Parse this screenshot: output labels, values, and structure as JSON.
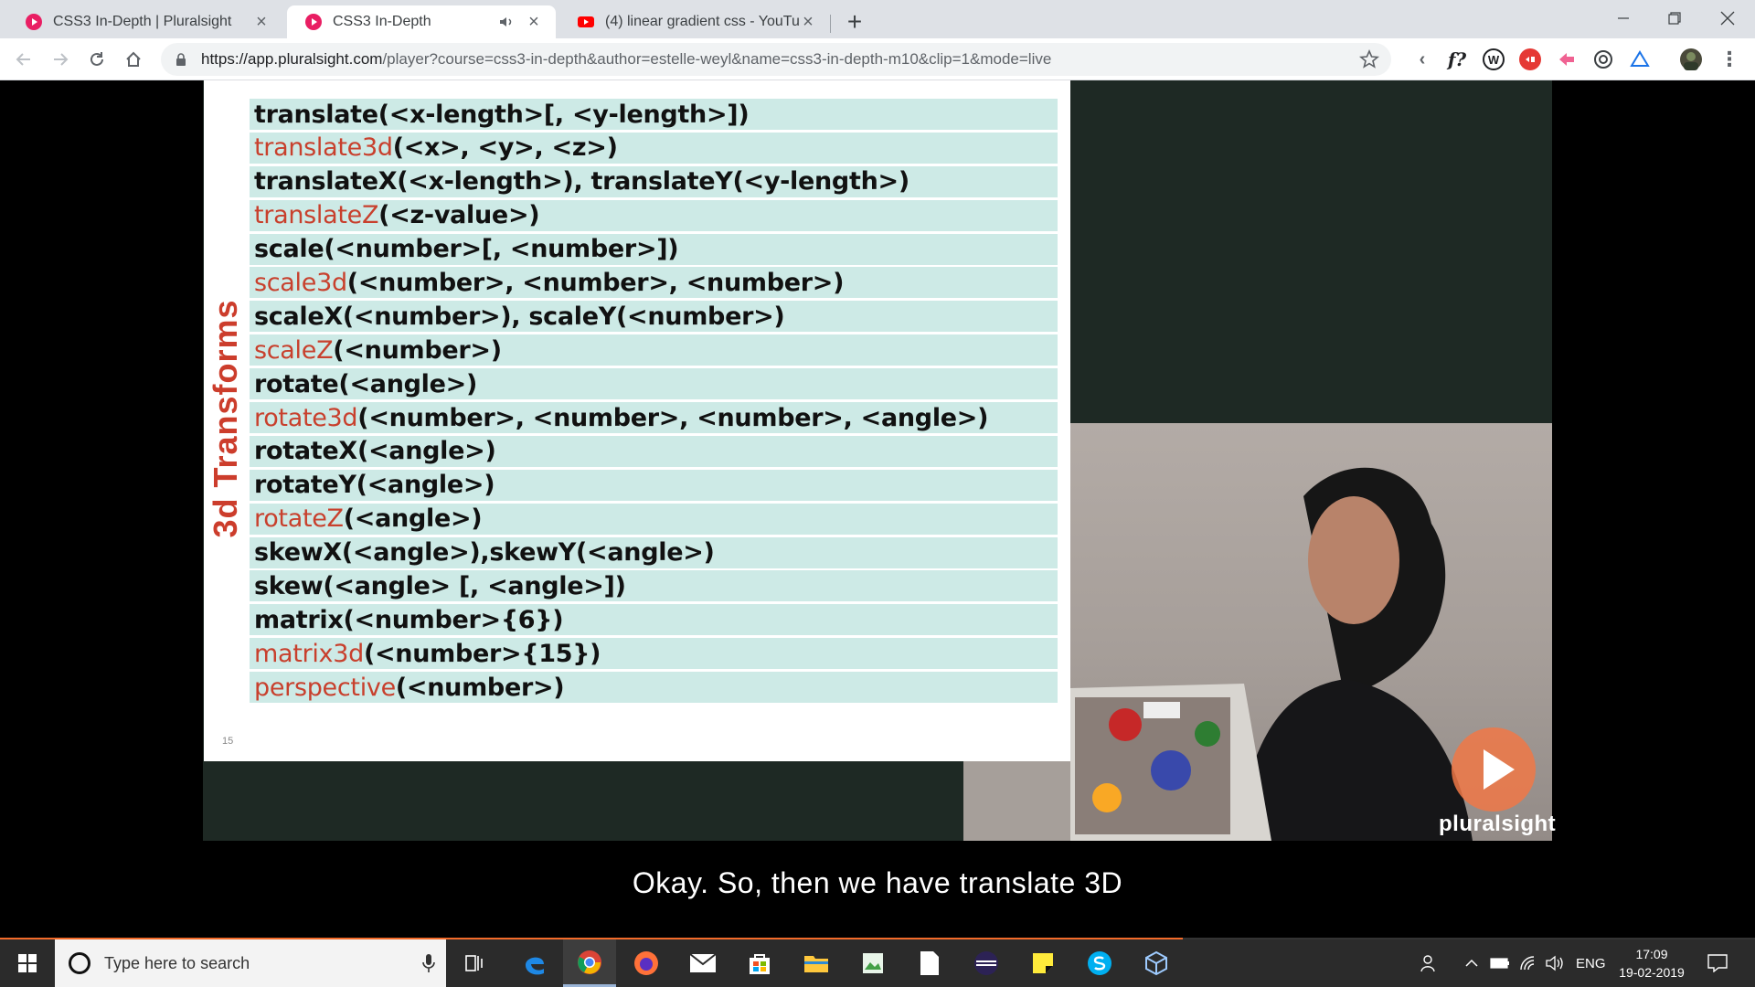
{
  "browser": {
    "tabs": [
      {
        "title": "CSS3 In-Depth | Pluralsight",
        "active": false
      },
      {
        "title": "CSS3 In-Depth",
        "active": true,
        "audio": true
      },
      {
        "title": "(4) linear gradient css - YouTube",
        "active": false
      }
    ],
    "url": {
      "host": "https://app.pluralsight.com",
      "rest": "/player?course=css3-in-depth&author=estelle-weyl&name=css3-in-depth-m10&clip=1&mode=live"
    },
    "extensions": [
      "f?",
      "W"
    ]
  },
  "slide": {
    "vertical_title": "3d Transforms",
    "rows": [
      {
        "fn": "translate",
        "args": "(<x-length>[, <y-length>])",
        "is_3d": false
      },
      {
        "fn": "translate3d",
        "args": "(<x>, <y>, <z>)",
        "is_3d": true
      },
      {
        "fn": "translateX",
        "args": "(<x-length>), translateY(<y-length>)",
        "is_3d": false
      },
      {
        "fn": "translateZ",
        "args": "(<z-value>)",
        "is_3d": true
      },
      {
        "fn": "scale",
        "args": "(<number>[, <number>])",
        "is_3d": false
      },
      {
        "fn": "scale3d",
        "args": "(<number>, <number>, <number>)",
        "is_3d": true
      },
      {
        "fn": "scaleX",
        "args": "(<number>), scaleY(<number>)",
        "is_3d": false
      },
      {
        "fn": "scaleZ",
        "args": "(<number>)",
        "is_3d": true
      },
      {
        "fn": "rotate",
        "args": "(<angle>)",
        "is_3d": false
      },
      {
        "fn": "rotate3d",
        "args": "(<number>, <number>, <number>, <angle>)",
        "is_3d": true
      },
      {
        "fn": "rotateX",
        "args": "(<angle>)",
        "is_3d": false
      },
      {
        "fn": "rotateY",
        "args": "(<angle>)",
        "is_3d": false
      },
      {
        "fn": "rotateZ",
        "args": "(<angle>)",
        "is_3d": true
      },
      {
        "fn": "skewX",
        "args": "(<angle>),skewY(<angle>)",
        "is_3d": false
      },
      {
        "fn": "skew",
        "args": "(<angle> [, <angle>])",
        "is_3d": false
      },
      {
        "fn": "matrix",
        "args": "(<number>{6})",
        "is_3d": false
      },
      {
        "fn": "matrix3d",
        "args": "(<number>{15})",
        "is_3d": true
      },
      {
        "fn": "perspective",
        "args": "(<number>)",
        "is_3d": true
      }
    ],
    "page_number": "15"
  },
  "player": {
    "brand": "pluralsight",
    "caption": "Okay. So, then we have translate 3D",
    "progress_fraction": 0.674
  },
  "taskbar": {
    "search_placeholder": "Type here to search",
    "language": "ENG",
    "time": "17:09",
    "date": "19-02-2019"
  },
  "colors": {
    "slide_3d_function": "#c8402d",
    "slide_row_bg": "#cdeae6",
    "accent_progress": "#f26b2a"
  }
}
